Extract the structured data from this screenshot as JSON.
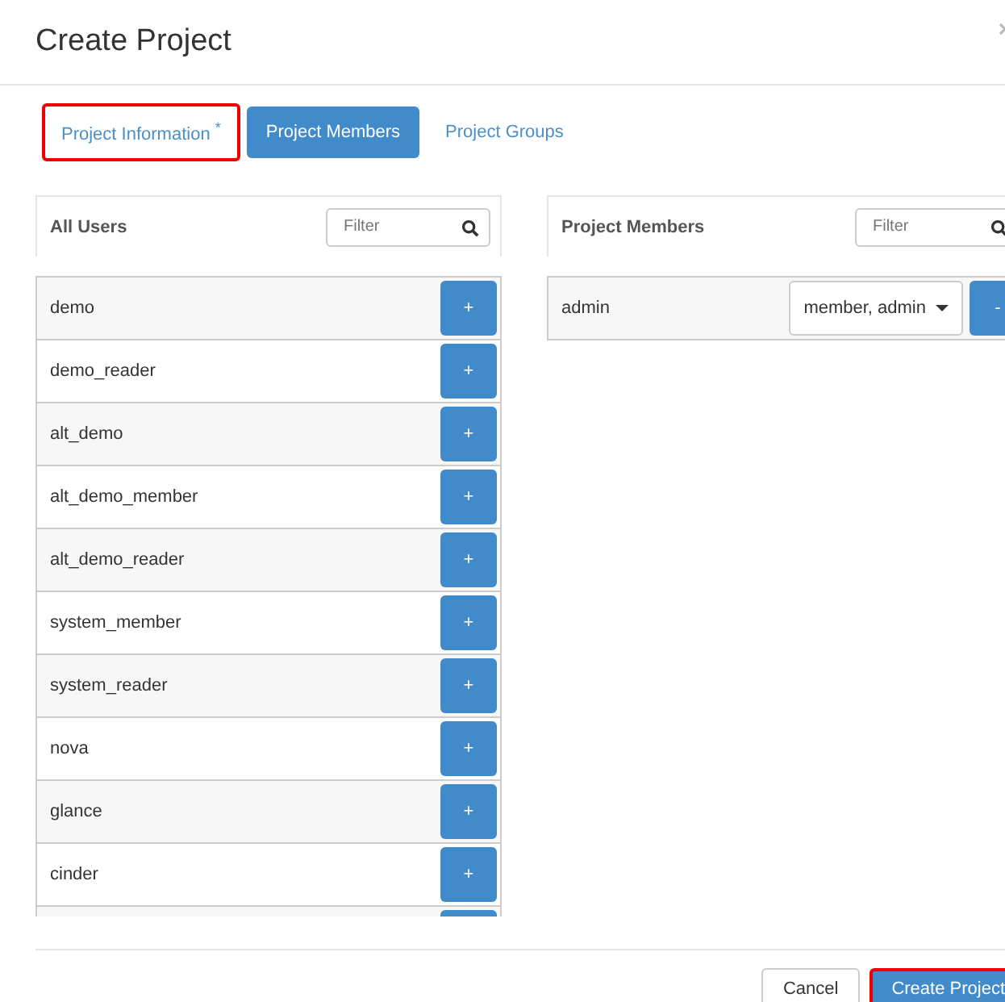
{
  "dialog": {
    "title": "Create Project"
  },
  "tabs": [
    {
      "label": "Project Information",
      "required_mark": "*",
      "selected": false,
      "highlighted": true
    },
    {
      "label": "Project Members",
      "selected": true,
      "highlighted": false
    },
    {
      "label": "Project Groups",
      "selected": false,
      "highlighted": false
    }
  ],
  "all_users": {
    "title": "All Users",
    "filter": {
      "placeholder": "Filter"
    },
    "rows": [
      {
        "name": "demo",
        "action": "+"
      },
      {
        "name": "demo_reader",
        "action": "+"
      },
      {
        "name": "alt_demo",
        "action": "+"
      },
      {
        "name": "alt_demo_member",
        "action": "+"
      },
      {
        "name": "alt_demo_reader",
        "action": "+"
      },
      {
        "name": "system_member",
        "action": "+"
      },
      {
        "name": "system_reader",
        "action": "+"
      },
      {
        "name": "nova",
        "action": "+"
      },
      {
        "name": "glance",
        "action": "+"
      },
      {
        "name": "cinder",
        "action": "+"
      }
    ]
  },
  "project_members": {
    "title": "Project Members",
    "filter": {
      "placeholder": "Filter"
    },
    "rows": [
      {
        "name": "admin",
        "roles": "member, admin",
        "action": "-"
      }
    ]
  },
  "footer": {
    "buttons": [
      {
        "label": "Cancel",
        "kind": "secondary",
        "highlighted": false
      },
      {
        "label": "Create Project",
        "kind": "primary",
        "highlighted": true
      }
    ]
  }
}
